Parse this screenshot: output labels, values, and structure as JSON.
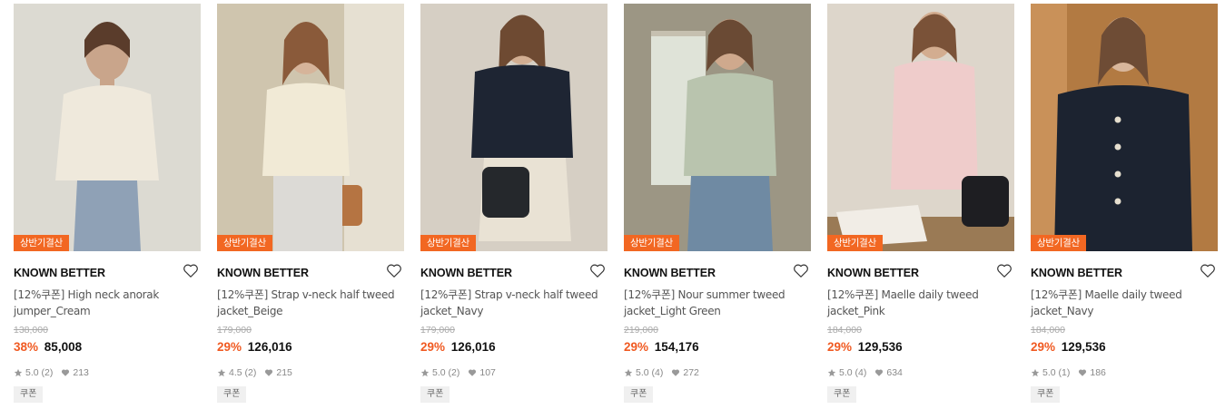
{
  "products": [
    {
      "badge": "상반기결산",
      "brand": "KNOWN BETTER",
      "name": "[12%쿠폰] High neck anorak jumper_Cream",
      "original_price": "138,000",
      "discount": "38%",
      "price": "85,008",
      "rating": "5.0",
      "reviews": "(2)",
      "likes": "213",
      "coupon": "쿠폰",
      "colors": {
        "bg": "#dcdad2",
        "item": "#efe9dc",
        "accent": "#8fa1b6"
      }
    },
    {
      "badge": "상반기결산",
      "brand": "KNOWN BETTER",
      "name": "[12%쿠폰] Strap v-neck half tweed jacket_Beige",
      "original_price": "179,000",
      "discount": "29%",
      "price": "126,016",
      "rating": "4.5",
      "reviews": "(2)",
      "likes": "215",
      "coupon": "쿠폰",
      "colors": {
        "bg": "#cfc5ae",
        "item": "#f1ead6",
        "accent": "#b57442"
      }
    },
    {
      "badge": "상반기결산",
      "brand": "KNOWN BETTER",
      "name": "[12%쿠폰] Strap v-neck half tweed jacket_Navy",
      "original_price": "179,000",
      "discount": "29%",
      "price": "126,016",
      "rating": "5.0",
      "reviews": "(2)",
      "likes": "107",
      "coupon": "쿠폰",
      "colors": {
        "bg": "#d6cfc4",
        "item": "#1e2533",
        "accent": "#e9e2d4"
      }
    },
    {
      "badge": "상반기결산",
      "brand": "KNOWN BETTER",
      "name": "[12%쿠폰] Nour summer tweed jacket_Light Green",
      "original_price": "219,000",
      "discount": "29%",
      "price": "154,176",
      "rating": "5.0",
      "reviews": "(4)",
      "likes": "272",
      "coupon": "쿠폰",
      "colors": {
        "bg": "#9c9684",
        "item": "#b9c4ae",
        "accent": "#6f8aa3"
      }
    },
    {
      "badge": "상반기결산",
      "brand": "KNOWN BETTER",
      "name": "[12%쿠폰] Maelle daily tweed jacket_Pink",
      "original_price": "184,000",
      "discount": "29%",
      "price": "129,536",
      "rating": "5.0",
      "reviews": "(4)",
      "likes": "634",
      "coupon": "쿠폰",
      "colors": {
        "bg": "#ddd6cb",
        "item": "#efcccb",
        "accent": "#1e1e22"
      }
    },
    {
      "badge": "상반기결산",
      "brand": "KNOWN BETTER",
      "name": "[12%쿠폰] Maelle daily tweed jacket_Navy",
      "original_price": "184,000",
      "discount": "29%",
      "price": "129,536",
      "rating": "5.0",
      "reviews": "(1)",
      "likes": "186",
      "coupon": "쿠폰",
      "colors": {
        "bg": "#b27a42",
        "item": "#1c2330",
        "accent": "#e6dfcf"
      }
    }
  ],
  "icons": {
    "wishlist": "heart-outline-icon",
    "rating": "star-icon",
    "likes": "heart-filled-icon"
  },
  "accent_colors": {
    "badge": "#f26722",
    "discount": "#f05a22"
  }
}
